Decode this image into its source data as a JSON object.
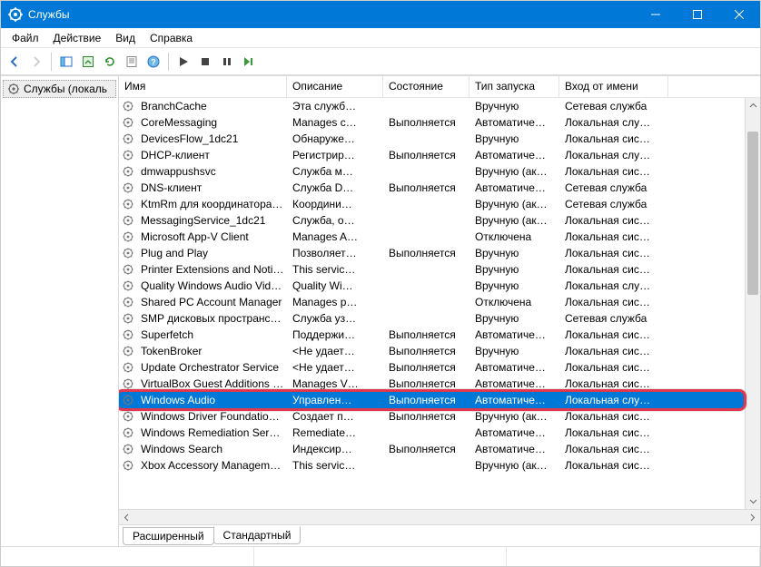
{
  "title": "Службы",
  "menu": [
    "Файл",
    "Действие",
    "Вид",
    "Справка"
  ],
  "tree": {
    "root": "Службы (локаль"
  },
  "columns": [
    "Имя",
    "Описание",
    "Состояние",
    "Тип запуска",
    "Вход от имени"
  ],
  "tabs": {
    "extended": "Расширенный",
    "standard": "Стандартный"
  },
  "services": [
    {
      "name": "BranchCache",
      "desc": "Эта служб…",
      "state": "",
      "start": "Вручную",
      "logon": "Сетевая служба"
    },
    {
      "name": "CoreMessaging",
      "desc": "Manages c…",
      "state": "Выполняется",
      "start": "Автоматиче…",
      "logon": "Локальная слу…"
    },
    {
      "name": "DevicesFlow_1dc21",
      "desc": "Обнаруже…",
      "state": "",
      "start": "Вручную",
      "logon": "Локальная сис…"
    },
    {
      "name": "DHCP-клиент",
      "desc": "Регистрир…",
      "state": "Выполняется",
      "start": "Автоматиче…",
      "logon": "Локальная слу…"
    },
    {
      "name": "dmwappushsvc",
      "desc": "Служба м…",
      "state": "",
      "start": "Вручную (ак…",
      "logon": "Локальная сис…"
    },
    {
      "name": "DNS-клиент",
      "desc": "Служба D…",
      "state": "Выполняется",
      "start": "Автоматиче…",
      "logon": "Сетевая служба"
    },
    {
      "name": "KtmRm для координатора …",
      "desc": "Координи…",
      "state": "",
      "start": "Вручную (ак…",
      "logon": "Сетевая служба"
    },
    {
      "name": "MessagingService_1dc21",
      "desc": "Служба, о…",
      "state": "",
      "start": "Вручную (ак…",
      "logon": "Локальная сис…"
    },
    {
      "name": "Microsoft App-V Client",
      "desc": "Manages A…",
      "state": "",
      "start": "Отключена",
      "logon": "Локальная сис…"
    },
    {
      "name": "Plug and Play",
      "desc": "Позволяет…",
      "state": "Выполняется",
      "start": "Вручную",
      "logon": "Локальная сис…"
    },
    {
      "name": "Printer Extensions and Notif…",
      "desc": "This servic…",
      "state": "",
      "start": "Вручную",
      "logon": "Локальная сис…"
    },
    {
      "name": "Quality Windows Audio Vid…",
      "desc": "Quality Wi…",
      "state": "",
      "start": "Вручную",
      "logon": "Локальная слу…"
    },
    {
      "name": "Shared PC Account Manager",
      "desc": "Manages p…",
      "state": "",
      "start": "Отключена",
      "logon": "Локальная сис…"
    },
    {
      "name": "SMP дисковых пространст…",
      "desc": "Служба уз…",
      "state": "",
      "start": "Вручную",
      "logon": "Сетевая служба"
    },
    {
      "name": "Superfetch",
      "desc": "Поддержи…",
      "state": "Выполняется",
      "start": "Автоматиче…",
      "logon": "Локальная сис…"
    },
    {
      "name": "TokenBroker",
      "desc": "<Не удает…",
      "state": "Выполняется",
      "start": "Вручную",
      "logon": "Локальная сис…"
    },
    {
      "name": "Update Orchestrator Service",
      "desc": "<Не удает…",
      "state": "Выполняется",
      "start": "Автоматиче…",
      "logon": "Локальная сис…"
    },
    {
      "name": "VirtualBox Guest Additions …",
      "desc": "Manages V…",
      "state": "Выполняется",
      "start": "Автоматиче…",
      "logon": "Локальная сис…"
    },
    {
      "name": "Windows Audio",
      "desc": "Управлен…",
      "state": "Выполняется",
      "start": "Автоматиче…",
      "logon": "Локальная слу…",
      "selected": true
    },
    {
      "name": "Windows Driver Foundation…",
      "desc": "Создает п…",
      "state": "Выполняется",
      "start": "Вручную (ак…",
      "logon": "Локальная сис…"
    },
    {
      "name": "Windows Remediation Servi…",
      "desc": "Remediate…",
      "state": "",
      "start": "Автоматиче…",
      "logon": "Локальная сис…"
    },
    {
      "name": "Windows Search",
      "desc": "Индексир…",
      "state": "Выполняется",
      "start": "Автоматиче…",
      "logon": "Локальная сис…"
    },
    {
      "name": "Xbox Accessory Manageme…",
      "desc": "This servic…",
      "state": "",
      "start": "Вручную (ак…",
      "logon": "Локальная сис…"
    }
  ]
}
